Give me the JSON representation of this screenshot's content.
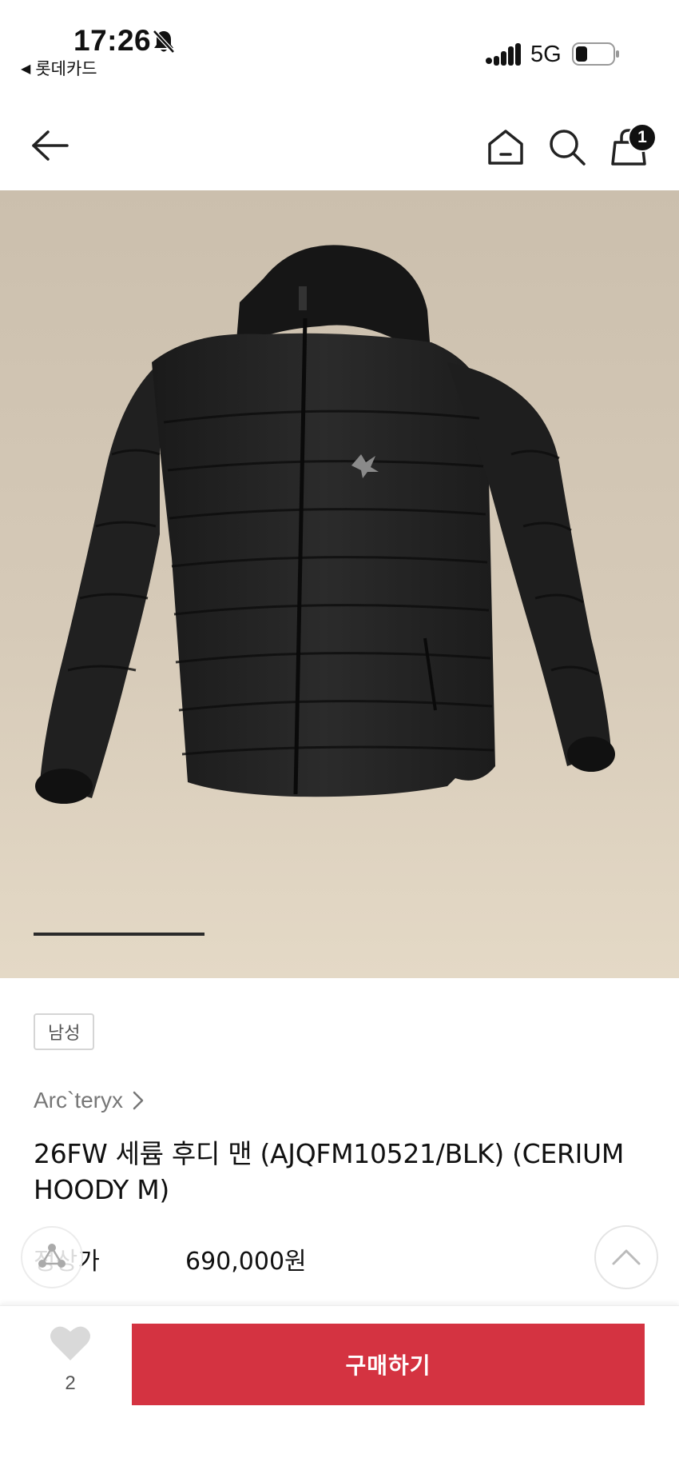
{
  "status_bar": {
    "time": "17:26",
    "back_app_label": "롯데카드",
    "network": "5G",
    "icons": [
      "bell-off-icon",
      "signal-icon",
      "battery-icon"
    ]
  },
  "header": {
    "icons": [
      "back-arrow-icon",
      "home-icon",
      "search-icon",
      "cart-icon"
    ],
    "cart_count": "1"
  },
  "gallery": {
    "image_alt": "product image",
    "progress": 0.28
  },
  "product": {
    "gender_tag": "남성",
    "brand": "Arc`teryx",
    "title": "26FW 세륨 후디 맨 (AJQFM10521/BLK) (CERIUM HOODY M)",
    "price_label": "정상가",
    "price_value": "690,000원"
  },
  "bottom_bar": {
    "wish_count": "2",
    "buy_label": "구매하기"
  },
  "colors": {
    "accent": "#d43341",
    "hero_bg": "#d6cab8"
  }
}
